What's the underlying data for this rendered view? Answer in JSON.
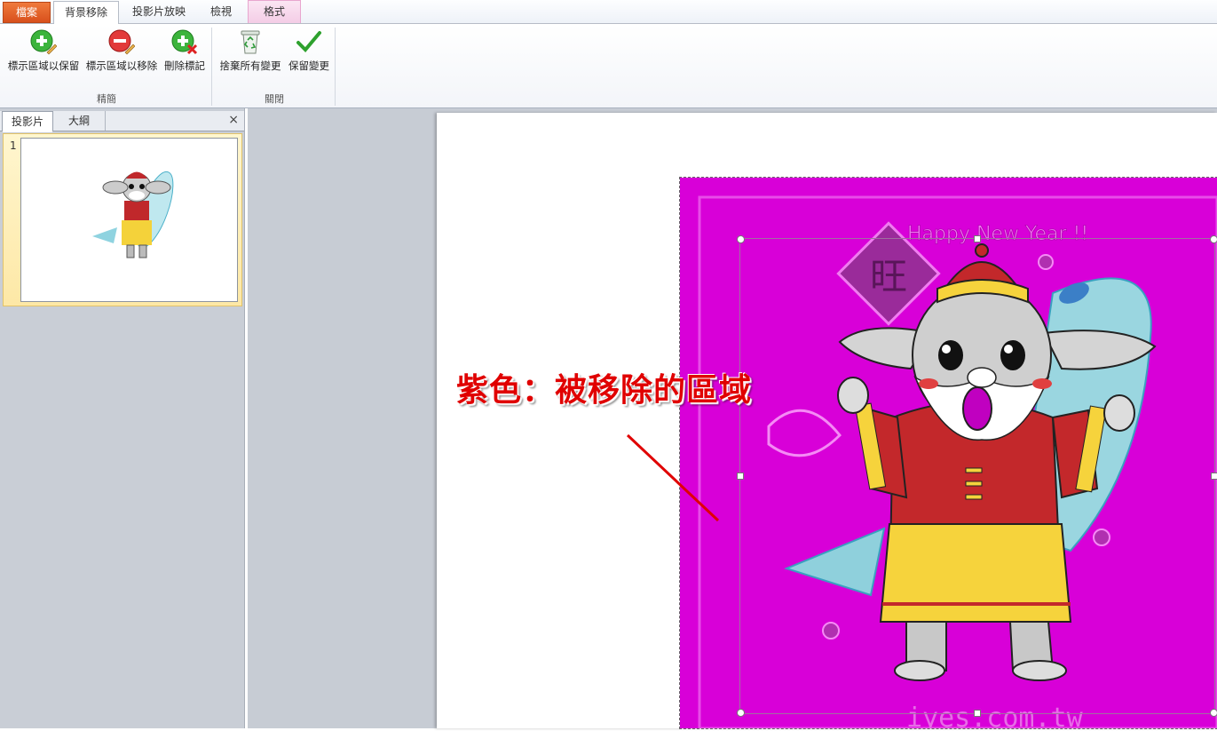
{
  "tabs": {
    "file": "檔案",
    "background_removal": "背景移除",
    "slideshow": "投影片放映",
    "view": "檢視",
    "format": "格式"
  },
  "ribbon": {
    "mark_keep": "標示區域以保留",
    "mark_remove": "標示區域以移除",
    "delete_mark": "刪除標記",
    "discard_all": "捨棄所有變更",
    "keep_changes": "保留變更",
    "group_refine": "精簡",
    "group_close": "關閉"
  },
  "left_pane": {
    "tab_slides": "投影片",
    "tab_outline": "大綱",
    "close": "×",
    "slide_number": "1"
  },
  "image": {
    "header_text": "Happy New Year !!",
    "char": "旺",
    "watermark": "iyes.com.tw",
    "removed_color": "#d800d8"
  },
  "annotation": {
    "text": "紫色：被移除的區域",
    "color": "#e00000"
  }
}
